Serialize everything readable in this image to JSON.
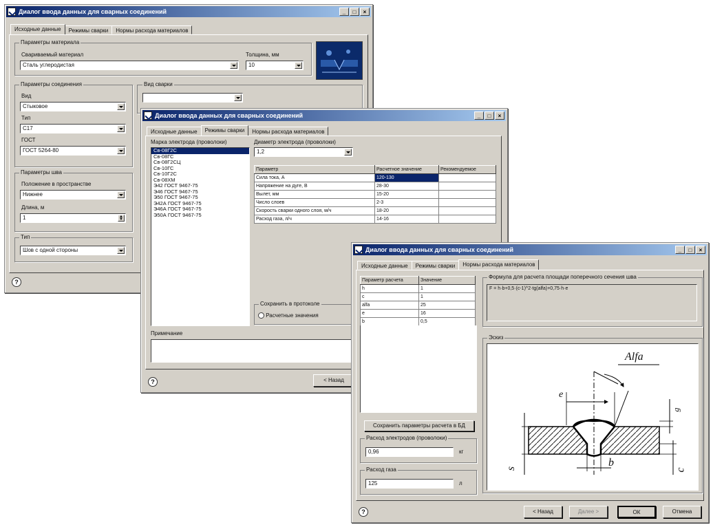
{
  "window1": {
    "title": "Диалог ввода данных для сварных соединений",
    "tabs": [
      "Исходные данные",
      "Режимы сварки",
      "Нормы расхода материалов"
    ],
    "material_group": {
      "title": "Параметры материала",
      "steel_label": "Свариваемый материал",
      "steel_value": "Сталь углеродистая",
      "thickness_label": "Толщина, мм",
      "thickness_value": "10"
    },
    "joint_group": {
      "title": "Параметры соединения",
      "type_label": "Вид",
      "type_value": "Стыковое",
      "kind_label": "Тип",
      "kind_value": "С17",
      "gost_label": "ГОСТ",
      "gost_value": "ГОСТ 5264-80"
    },
    "weld_type_label": "Вид сварки",
    "seam_group": {
      "title": "Параметры шва",
      "position_label": "Положение в пространстве",
      "position_value": "Нижнее",
      "length_label": "Длина, м",
      "length_value": "1"
    },
    "type2_group": {
      "title": "Тип",
      "value": "Шов с одной стороны"
    }
  },
  "window2": {
    "title": "Диалог ввода данных для сварных соединений",
    "tabs": [
      "Исходные данные",
      "Режимы сварки",
      "Нормы расхода материалов"
    ],
    "electrode_brand_label": "Марка электрода (проволоки)",
    "electrodes": [
      "Св-08Г2С",
      "Св-08ГС",
      "Св-08Г2СЦ",
      "Св-10ГС",
      "Св-10Г2С",
      "Св-08ХМ",
      "Э42 ГОСТ 9467-75",
      "Э46 ГОСТ 9467-75",
      "Э50 ГОСТ 9467-75",
      "Э42А ГОСТ 9467-75",
      "Э46А ГОСТ 9467-75",
      "Э50А ГОСТ 9467-75"
    ],
    "diameter_label": "Диаметр электрода (проволоки)",
    "diameter_value": "1,2",
    "table_headers": [
      "Параметр",
      "Расчетное значение",
      "Рекомендуемое"
    ],
    "table_rows": [
      [
        "Сила тока, А",
        "120-130",
        ""
      ],
      [
        "Напряжение на дуге, В",
        "28-30",
        ""
      ],
      [
        "Вылет, мм",
        "15-20",
        ""
      ],
      [
        "Число слоев",
        "2-3",
        ""
      ],
      [
        "Скорость сварки одного слоя, м/ч",
        "18-20",
        ""
      ],
      [
        "Расход газа, л/ч",
        "14-16",
        ""
      ]
    ],
    "save_group_title": "Сохранить в протоколе",
    "save_option": "Расчетные значения",
    "notes_label": "Примечание",
    "back_button": "< Назад"
  },
  "window3": {
    "title": "Диалог ввода данных для сварных соединений",
    "tabs": [
      "Исходные данные",
      "Режимы сварки",
      "Нормы расхода материалов"
    ],
    "params_headers": [
      "Параметр расчета",
      "Значение"
    ],
    "params_rows": [
      [
        "h",
        "1"
      ],
      [
        "c",
        "1"
      ],
      [
        "alfa",
        "25"
      ],
      [
        "e",
        "16"
      ],
      [
        "b",
        "0,5"
      ]
    ],
    "formula_title": "Формула для расчета площади поперечного сечения шва",
    "formula_text": "F = h·b+0,5·(c-1)^2·tg(alfa)+0,75·h·e",
    "sketch_title": "Эскиз",
    "sketch_labels": {
      "alfa": "Alfa",
      "e": "e",
      "b": "b",
      "s": "s",
      "c": "c",
      "g": "g"
    },
    "calc_button": "Сохранить параметры расчета в БД",
    "electrode_consumption_title": "Расход электродов (проволоки)",
    "electrode_consumption_value": "0,96",
    "electrode_unit": "кг",
    "gas_consumption_title": "Расход газа",
    "gas_consumption_value": "125",
    "gas_unit": "л",
    "buttons": {
      "back": "< Назад",
      "next": "Далее >",
      "ok": "ОК",
      "cancel": "Отмена"
    }
  },
  "colors": {
    "titlebar": "#0a246a",
    "face": "#d4d0c8",
    "selection": "#0a246a"
  }
}
